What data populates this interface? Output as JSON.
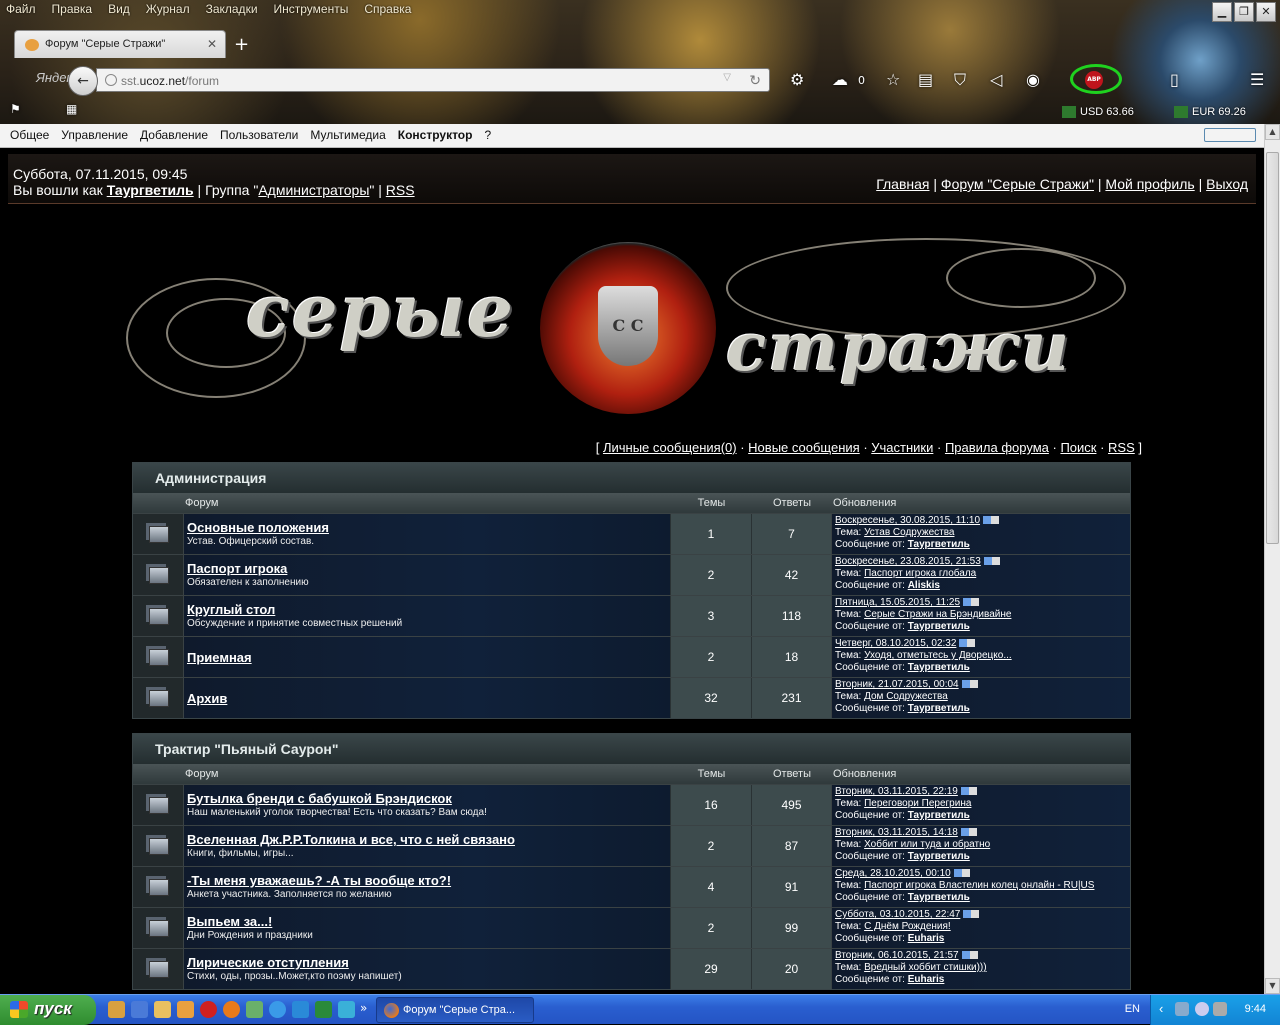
{
  "browser": {
    "menu": [
      "Файл",
      "Правка",
      "Вид",
      "Журнал",
      "Закладки",
      "Инструменты",
      "Справка"
    ],
    "tab_title": "Форум \"Серые Стражи\"",
    "search_engine": "Яндекс",
    "url_prefix": "sst.",
    "url_domain": "ucoz.net",
    "url_path": "/forum",
    "weather_value": "0",
    "abp_label": "ABP",
    "usd_rate": "USD 63.66",
    "eur_rate": "EUR 69.26"
  },
  "admin_bar": {
    "items": [
      "Общее",
      "Управление",
      "Добавление",
      "Пользователи",
      "Мультимедиа"
    ],
    "constructor": "Конструктор",
    "help": "?"
  },
  "header": {
    "date_line": "Суббота, 07.11.2015, 09:45",
    "logged_prefix": "Вы вошли как ",
    "username": "Таургветиль",
    "group_prefix": " | Группа \"",
    "group_name": "Администраторы",
    "group_suffix": "\" | ",
    "rss": "RSS",
    "nav": {
      "home": "Главная",
      "forum": "Форум \"Серые Стражи\"",
      "profile": "Мой профиль",
      "logout": "Выход",
      "sep": " | "
    }
  },
  "logo": {
    "word1": "серые",
    "word2": "стражи",
    "emblem": "С С"
  },
  "quick_links": {
    "open": "[ ",
    "pm": "Личные сообщения(0)",
    "new": "Новые сообщения",
    "members": "Участники",
    "rules": "Правила форума",
    "search": "Поиск",
    "rss": "RSS",
    "sep": " · ",
    "close": " ]"
  },
  "columns": {
    "forum": "Форум",
    "topics": "Темы",
    "replies": "Ответы",
    "updates": "Обновления"
  },
  "labels": {
    "topic": "Тема: ",
    "from": "Сообщение от: "
  },
  "categories": [
    {
      "title": "Администрация",
      "forums": [
        {
          "name": "Основные положения",
          "desc": "Устав. Офицерский состав.",
          "topics": "1",
          "replies": "7",
          "date": "Воскресенье, 30.08.2015, 11:10",
          "topic": "Устав Содружества",
          "author": "Таургветиль"
        },
        {
          "name": "Паспорт игрока",
          "desc": "Обязателен к заполнению",
          "topics": "2",
          "replies": "42",
          "date": "Воскресенье, 23.08.2015, 21:53",
          "topic": "Паспорт игрока глобала",
          "author": "Aliskis"
        },
        {
          "name": "Круглый стол",
          "desc": "Обсуждение и принятие совместных решений",
          "topics": "3",
          "replies": "118",
          "date": "Пятница, 15.05.2015, 11:25",
          "topic": "Серые Стражи на Брэндивайне",
          "author": "Таургветиль"
        },
        {
          "name": "Приемная",
          "desc": "",
          "topics": "2",
          "replies": "18",
          "date": "Четверг, 08.10.2015, 02:32",
          "topic": "Уходя, отметьтесь у Дворецко...",
          "author": "Таургветиль"
        },
        {
          "name": "Архив",
          "desc": "",
          "topics": "32",
          "replies": "231",
          "date": "Вторник, 21.07.2015, 00:04",
          "topic": "Дом Содружества",
          "author": "Таургветиль"
        }
      ]
    },
    {
      "title": "Трактир \"Пьяный Саурон\"",
      "forums": [
        {
          "name": "Бутылка бренди с бабушкой Брэндискок",
          "desc": "Наш маленький уголок творчества! Есть что сказать? Вам сюда!",
          "topics": "16",
          "replies": "495",
          "date": "Вторник, 03.11.2015, 22:19",
          "topic": "Переговори Перегрина",
          "author": "Таургветиль"
        },
        {
          "name": "Вселенная Дж.Р.Р.Толкина и все, что с ней связано",
          "desc": "Книги, фильмы, игры...",
          "topics": "2",
          "replies": "87",
          "date": "Вторник, 03.11.2015, 14:18",
          "topic": "Хоббит или туда и обратно",
          "author": "Таургветиль"
        },
        {
          "name": "-Ты меня уважаешь? -А ты вообще кто?!",
          "desc": "Анкета участника. Заполняется по желанию",
          "topics": "4",
          "replies": "91",
          "date": "Среда, 28.10.2015, 00:10",
          "topic": "Паспорт игрока Властелин колец онлайн - RU|US",
          "author": "Таургветиль"
        },
        {
          "name": "Выпьем за...!",
          "desc": "Дни Рождения и праздники",
          "topics": "2",
          "replies": "99",
          "date": "Суббота, 03.10.2015, 22:47",
          "topic": "С Днём Рождения!",
          "author": "Euharis"
        },
        {
          "name": "Лирические отступления",
          "desc": "Стихи, оды, прозы..Может,кто поэму напишет)",
          "topics": "29",
          "replies": "20",
          "date": "Вторник, 06.10.2015, 21:57",
          "topic": "Вредный хоббит стишки)))",
          "author": "Euharis"
        }
      ]
    }
  ],
  "taskbar": {
    "start": "пуск",
    "task_title": "Форум \"Серые Стра...",
    "lang": "EN",
    "clock": "9:44",
    "more": "»"
  }
}
